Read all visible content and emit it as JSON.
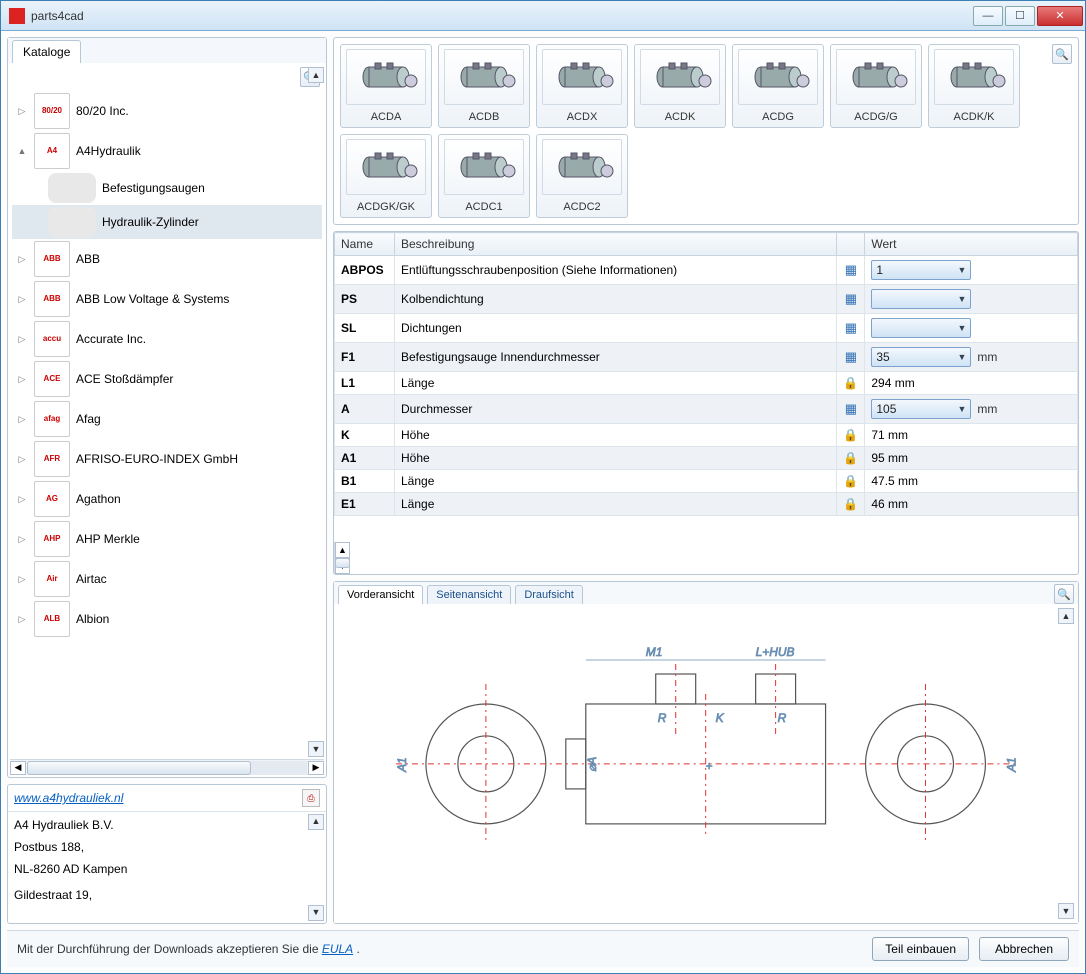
{
  "window": {
    "title": "parts4cad"
  },
  "sidebar": {
    "tab_label": "Kataloge",
    "items": [
      {
        "label": "80/20 Inc.",
        "logo": "80/20",
        "expander": "▷"
      },
      {
        "label": "A4Hydraulik",
        "logo": "A4",
        "expander": "▲",
        "expanded": true,
        "children": [
          {
            "label": "Befestigungsaugen"
          },
          {
            "label": "Hydraulik-Zylinder",
            "selected": true
          }
        ]
      },
      {
        "label": "ABB",
        "logo": "ABB",
        "expander": "▷"
      },
      {
        "label": "ABB Low Voltage & Systems",
        "logo": "ABB",
        "expander": "▷"
      },
      {
        "label": "Accurate Inc.",
        "logo": "accu",
        "expander": "▷"
      },
      {
        "label": "ACE Stoßdämpfer",
        "logo": "ACE",
        "expander": "▷"
      },
      {
        "label": "Afag",
        "logo": "afag",
        "expander": "▷"
      },
      {
        "label": "AFRISO-EURO-INDEX GmbH",
        "logo": "AFR",
        "expander": "▷"
      },
      {
        "label": "Agathon",
        "logo": "AG",
        "expander": "▷"
      },
      {
        "label": "AHP Merkle",
        "logo": "AHP",
        "expander": "▷"
      },
      {
        "label": "Airtac",
        "logo": "Air",
        "expander": "▷"
      },
      {
        "label": "Albion",
        "logo": "ALB",
        "expander": "▷"
      }
    ]
  },
  "info": {
    "link": "www.a4hydrauliek.nl",
    "line1": "A4 Hydrauliek B.V.",
    "line2": "Postbus 188,",
    "line3": "NL-8260 AD Kampen",
    "line4": "Gildestraat 19,"
  },
  "thumbs": [
    {
      "label": "ACDA"
    },
    {
      "label": "ACDB"
    },
    {
      "label": "ACDX"
    },
    {
      "label": "ACDK"
    },
    {
      "label": "ACDG"
    },
    {
      "label": "ACDG/G"
    },
    {
      "label": "ACDK/K"
    },
    {
      "label": "ACDGK/GK"
    },
    {
      "label": "ACDC1"
    },
    {
      "label": "ACDC2"
    }
  ],
  "params": {
    "headers": {
      "name": "Name",
      "desc": "Beschreibung",
      "value": "Wert"
    },
    "rows": [
      {
        "name": "ABPOS",
        "desc": "Entlüftungsschraubenposition (Siehe Informationen)",
        "icon": "grid",
        "dd": "1",
        "unit": "",
        "odd": true
      },
      {
        "name": "PS",
        "desc": "Kolbendichtung",
        "icon": "grid",
        "dd": "",
        "unit": "",
        "odd": false
      },
      {
        "name": "SL",
        "desc": "Dichtungen",
        "icon": "grid",
        "dd": "",
        "unit": "",
        "odd": true
      },
      {
        "name": "F1",
        "desc": "Befestigungsauge Innendurchmesser",
        "icon": "grid",
        "dd": "35",
        "unit": "mm",
        "odd": false
      },
      {
        "name": "L1",
        "desc": "Länge",
        "icon": "lock",
        "text": "294 mm",
        "odd": true
      },
      {
        "name": "A",
        "desc": "Durchmesser",
        "icon": "grid",
        "dd": "105",
        "unit": "mm",
        "odd": false
      },
      {
        "name": "K",
        "desc": "Höhe",
        "icon": "lock",
        "text": "71 mm",
        "odd": true
      },
      {
        "name": "A1",
        "desc": "Höhe",
        "icon": "lock",
        "text": "95 mm",
        "odd": false
      },
      {
        "name": "B1",
        "desc": "Länge",
        "icon": "lock",
        "text": "47.5 mm",
        "odd": true
      },
      {
        "name": "E1",
        "desc": "Länge",
        "icon": "lock",
        "text": "46 mm",
        "odd": false
      }
    ]
  },
  "preview": {
    "tabs": [
      {
        "label": "Vorderansicht",
        "active": true
      },
      {
        "label": "Seitenansicht",
        "active": false
      },
      {
        "label": "Draufsicht",
        "active": false
      }
    ],
    "dims": {
      "m1": "M1",
      "lhub": "L+HUB",
      "r": "R",
      "k": "K",
      "phiA": "⌀A",
      "a1": "A1"
    }
  },
  "footer": {
    "msg_prefix": "Mit der Durchführung der Downloads akzeptieren Sie die ",
    "msg_link": "EULA",
    "msg_suffix": " .",
    "btn_build": "Teil einbauen",
    "btn_cancel": "Abbrechen"
  }
}
